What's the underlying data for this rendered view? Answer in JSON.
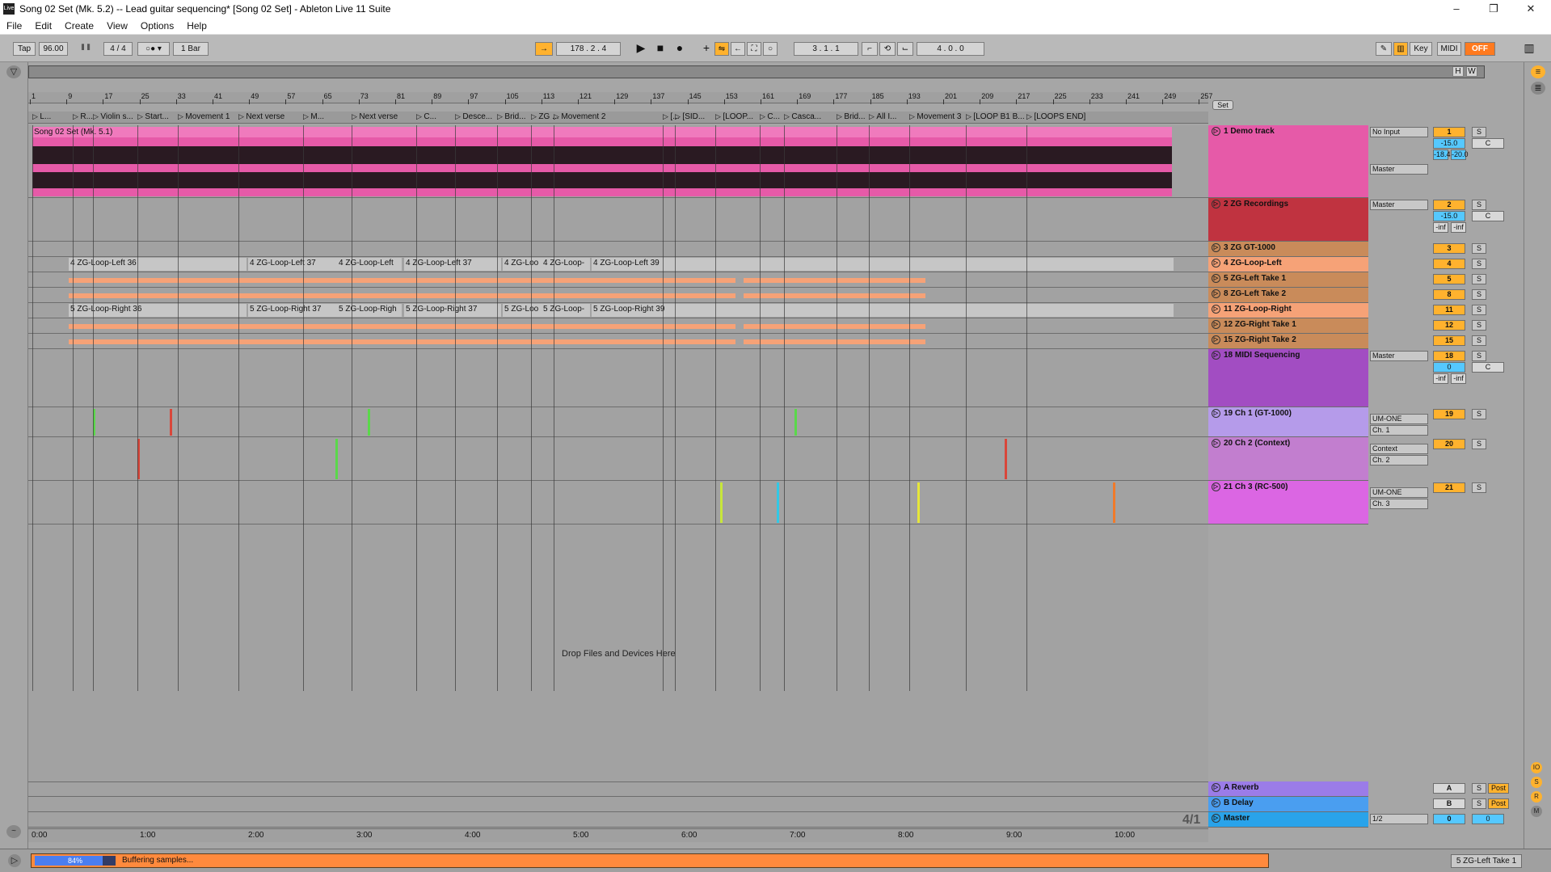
{
  "window": {
    "title": "Song 02 Set (Mk. 5.2) -- Lead guitar sequencing*  [Song 02 Set] - Ableton Live 11 Suite",
    "app_icon": "Live",
    "minimize": "–",
    "maximize": "❐",
    "close": "✕"
  },
  "menu": [
    "File",
    "Edit",
    "Create",
    "View",
    "Options",
    "Help"
  ],
  "toolbar": {
    "tap": "Tap",
    "tempo": "96.00",
    "signature": "4 / 4",
    "quantize": "1 Bar",
    "position": "178 .  2 .  4",
    "loop_start": "3 .  1 .  1",
    "loop_length": "4 .  0 .  0",
    "key": "Key",
    "midi": "MIDI",
    "cpu": "OFF"
  },
  "overview": {
    "h": "H",
    "w": "W"
  },
  "ruler_ticks": [
    "1",
    "9",
    "17",
    "25",
    "33",
    "41",
    "49",
    "57",
    "65",
    "73",
    "81",
    "89",
    "97",
    "105",
    "113",
    "121",
    "129",
    "137",
    "145",
    "153",
    "161",
    "169",
    "177",
    "185",
    "193",
    "201",
    "209",
    "217",
    "225",
    "233",
    "241",
    "249",
    "257"
  ],
  "locators": [
    "L...",
    "R...",
    "Violin s...",
    "Start...",
    "Movement 1",
    "Next verse",
    "M...",
    "Next verse",
    "C...",
    "Desce...",
    "Brid...",
    "ZG ...",
    "Movement 2",
    "[...",
    "[SID...",
    "[LOOP...",
    "C...",
    "Casca...",
    "Brid...",
    "All I...",
    "Movement 3",
    "[LOOP B1 B...",
    "[LOOPS END]"
  ],
  "clips": {
    "demo": "Song 02 Set (Mk. 5.1)",
    "left": [
      "4 ZG-Loop-Left 36",
      "4 ZG-Loop-Left 37",
      "4 ZG-Loop-Left",
      "4 ZG-Loop-Left 37",
      "4 ZG-Loo",
      "4 ZG-Loop-",
      "4 ZG-Loop-Left 39"
    ],
    "right": [
      "5 ZG-Loop-Right 36",
      "5 ZG-Loop-Right 37",
      "5 ZG-Loop-Righ",
      "5 ZG-Loop-Right 37",
      "5 ZG-Loo",
      "5 ZG-Loop-",
      "5 ZG-Loop-Right 39"
    ]
  },
  "drop_text": "Drop Files and Devices Here",
  "time_ticks": [
    "0:00",
    "1:00",
    "2:00",
    "3:00",
    "4:00",
    "5:00",
    "6:00",
    "7:00",
    "8:00",
    "9:00",
    "10:00"
  ],
  "set_label": "Set",
  "tracks": [
    {
      "name": "1 Demo track",
      "color": "#e65aa8",
      "num": "1",
      "input": "No Input",
      "output": "Master",
      "vol": "-15.0",
      "pan": "C",
      "peak_l": "-18.4",
      "peak_r": "-20.0"
    },
    {
      "name": "2 ZG Recordings",
      "color": "#c03340",
      "num": "2",
      "output": "Master",
      "vol": "-15.0",
      "pan": "C",
      "peak_l": "-inf",
      "peak_r": "-inf"
    },
    {
      "name": "3 ZG GT-1000",
      "color": "#c98b5a",
      "num": "3"
    },
    {
      "name": "4 ZG-Loop-Left",
      "color": "#f6a277",
      "num": "4"
    },
    {
      "name": "5 ZG-Left Take 1",
      "color": "#c98b5a",
      "num": "5"
    },
    {
      "name": "8 ZG-Left Take 2",
      "color": "#c98b5a",
      "num": "8"
    },
    {
      "name": "11 ZG-Loop-Right",
      "color": "#f6a277",
      "num": "11"
    },
    {
      "name": "12 ZG-Right Take 1",
      "color": "#c98b5a",
      "num": "12"
    },
    {
      "name": "15 ZG-Right Take 2",
      "color": "#c98b5a",
      "num": "15"
    },
    {
      "name": "18 MIDI Sequencing",
      "color": "#a24dc2",
      "num": "18",
      "output": "Master",
      "vol": "0",
      "pan": "C",
      "peak_l": "-inf",
      "peak_r": "-inf"
    },
    {
      "name": "19 Ch 1 (GT-1000)",
      "color": "#b59bea",
      "num": "19",
      "output": "UM-ONE",
      "channel": "Ch. 1"
    },
    {
      "name": "20 Ch 2 (Context)",
      "color": "#c27ecf",
      "num": "20",
      "output": "Context",
      "channel": "Ch. 2"
    },
    {
      "name": "21 Ch 3 (RC-500)",
      "color": "#db66e3",
      "num": "21",
      "output": "UM-ONE",
      "channel": "Ch. 3"
    }
  ],
  "returns": [
    {
      "name": "A Reverb",
      "color": "#9b7ce8",
      "num": "A",
      "post": "Post"
    },
    {
      "name": "B Delay",
      "color": "#4a9ef0",
      "num": "B",
      "post": "Post"
    },
    {
      "name": "Master",
      "color": "#29a3ea",
      "num": "0",
      "output": "1/2",
      "vol": "0"
    }
  ],
  "solo": "S",
  "bar_fraction": "4/1",
  "status": {
    "percent": "84%",
    "text": "Buffering samples...",
    "percent_value": 0.84,
    "current_clip": "5 ZG-Left Take 1"
  },
  "icons": {
    "play": "play-icon",
    "stop": "stop-icon",
    "record": "record-icon"
  }
}
